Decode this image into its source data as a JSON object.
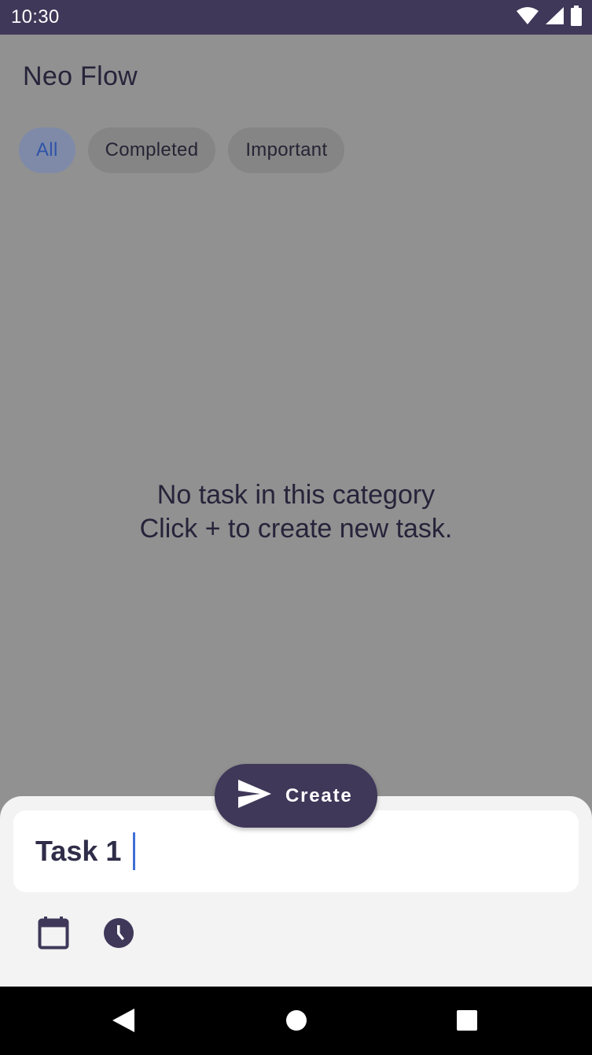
{
  "status_bar": {
    "time": "10:30",
    "icons": [
      "wifi-icon",
      "signal-icon",
      "battery-icon"
    ]
  },
  "app": {
    "title": "Neo Flow"
  },
  "filters": {
    "items": [
      {
        "label": "All",
        "selected": true
      },
      {
        "label": "Completed",
        "selected": false
      },
      {
        "label": "Important",
        "selected": false
      }
    ]
  },
  "empty_state": {
    "line1": "No task in this category",
    "line2": "Click + to create new task."
  },
  "create_sheet": {
    "task_value": "Task 1",
    "icons": [
      "calendar-icon",
      "clock-icon"
    ]
  },
  "fab": {
    "label": "Create",
    "icon": "send-icon"
  },
  "nav_bar": {
    "icons": [
      "back-icon",
      "home-icon",
      "recents-icon"
    ]
  },
  "colors": {
    "primary": "#3f3859",
    "scrim_bg": "#919191",
    "chip_selected_text": "#2f53a8",
    "caret": "#3f6fd6"
  }
}
